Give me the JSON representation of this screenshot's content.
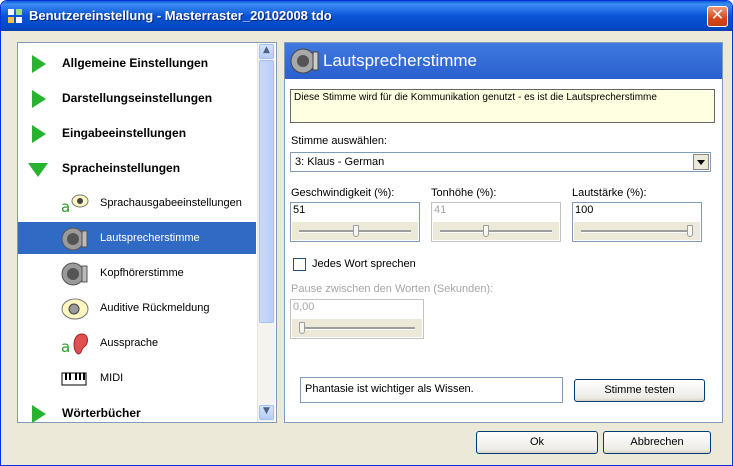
{
  "window": {
    "title": "Benutzereinstellung - Masterraster_20102008 tdo",
    "close_glyph": "✕"
  },
  "tree": {
    "items": [
      {
        "kind": "category",
        "label": "Allgemeine Einstellungen",
        "icon": "green-arrow-right-icon"
      },
      {
        "kind": "category",
        "label": "Darstellungseinstellungen",
        "icon": "green-arrow-right-icon"
      },
      {
        "kind": "category",
        "label": "Eingabeeinstellungen",
        "icon": "green-arrow-right-icon"
      },
      {
        "kind": "category",
        "label": "Spracheinstellungen",
        "icon": "green-arrow-down-icon",
        "expanded": true
      },
      {
        "kind": "sub",
        "label": "Sprachausgabeeinstellungen",
        "icon": "speech-output-icon"
      },
      {
        "kind": "sub",
        "label": "Lautsprecherstimme",
        "icon": "speaker-icon",
        "selected": true
      },
      {
        "kind": "sub",
        "label": "Kopfhörerstimme",
        "icon": "headphone-speaker-icon"
      },
      {
        "kind": "sub",
        "label": "Auditive Rückmeldung",
        "icon": "auditive-feedback-icon"
      },
      {
        "kind": "sub",
        "label": "Aussprache",
        "icon": "ear-icon"
      },
      {
        "kind": "sub",
        "label": "MIDI",
        "icon": "piano-keys-icon"
      },
      {
        "kind": "category",
        "label": "Wörterbücher",
        "icon": "green-arrow-right-icon"
      }
    ],
    "scroll_up": "▲",
    "scroll_down": "▼"
  },
  "panel": {
    "title": "Lautsprecherstimme",
    "info": "Diese Stimme wird für die Kommunikation genutzt - es ist die Lautsprecherstimme",
    "voice_label": "Stimme auswählen:",
    "voice_value": "3: Klaus - German",
    "speed": {
      "label": "Geschwindigkeit (%):",
      "value": "51",
      "level": 0.51
    },
    "pitch": {
      "label": "Tonhöhe (%):",
      "value": "41",
      "level": 0.41,
      "disabled": true
    },
    "volume": {
      "label": "Lautstärke (%):",
      "value": "100",
      "level": 1.0
    },
    "each_word": {
      "label": "Jedes Wort sprechen",
      "checked": false
    },
    "pause": {
      "label": "Pause zwischen den Worten (Sekunden):",
      "value": "0,00",
      "level": 0.0,
      "disabled": true
    },
    "test_text": "Phantasie ist wichtiger als Wissen.",
    "test_button": "Stimme testen"
  },
  "footer": {
    "ok": "Ok",
    "cancel": "Abbrechen"
  },
  "colors": {
    "accent": "#316ac5",
    "title_blue": "#0a54d6",
    "green": "#27b22f",
    "info_bg": "#ffffe1"
  }
}
